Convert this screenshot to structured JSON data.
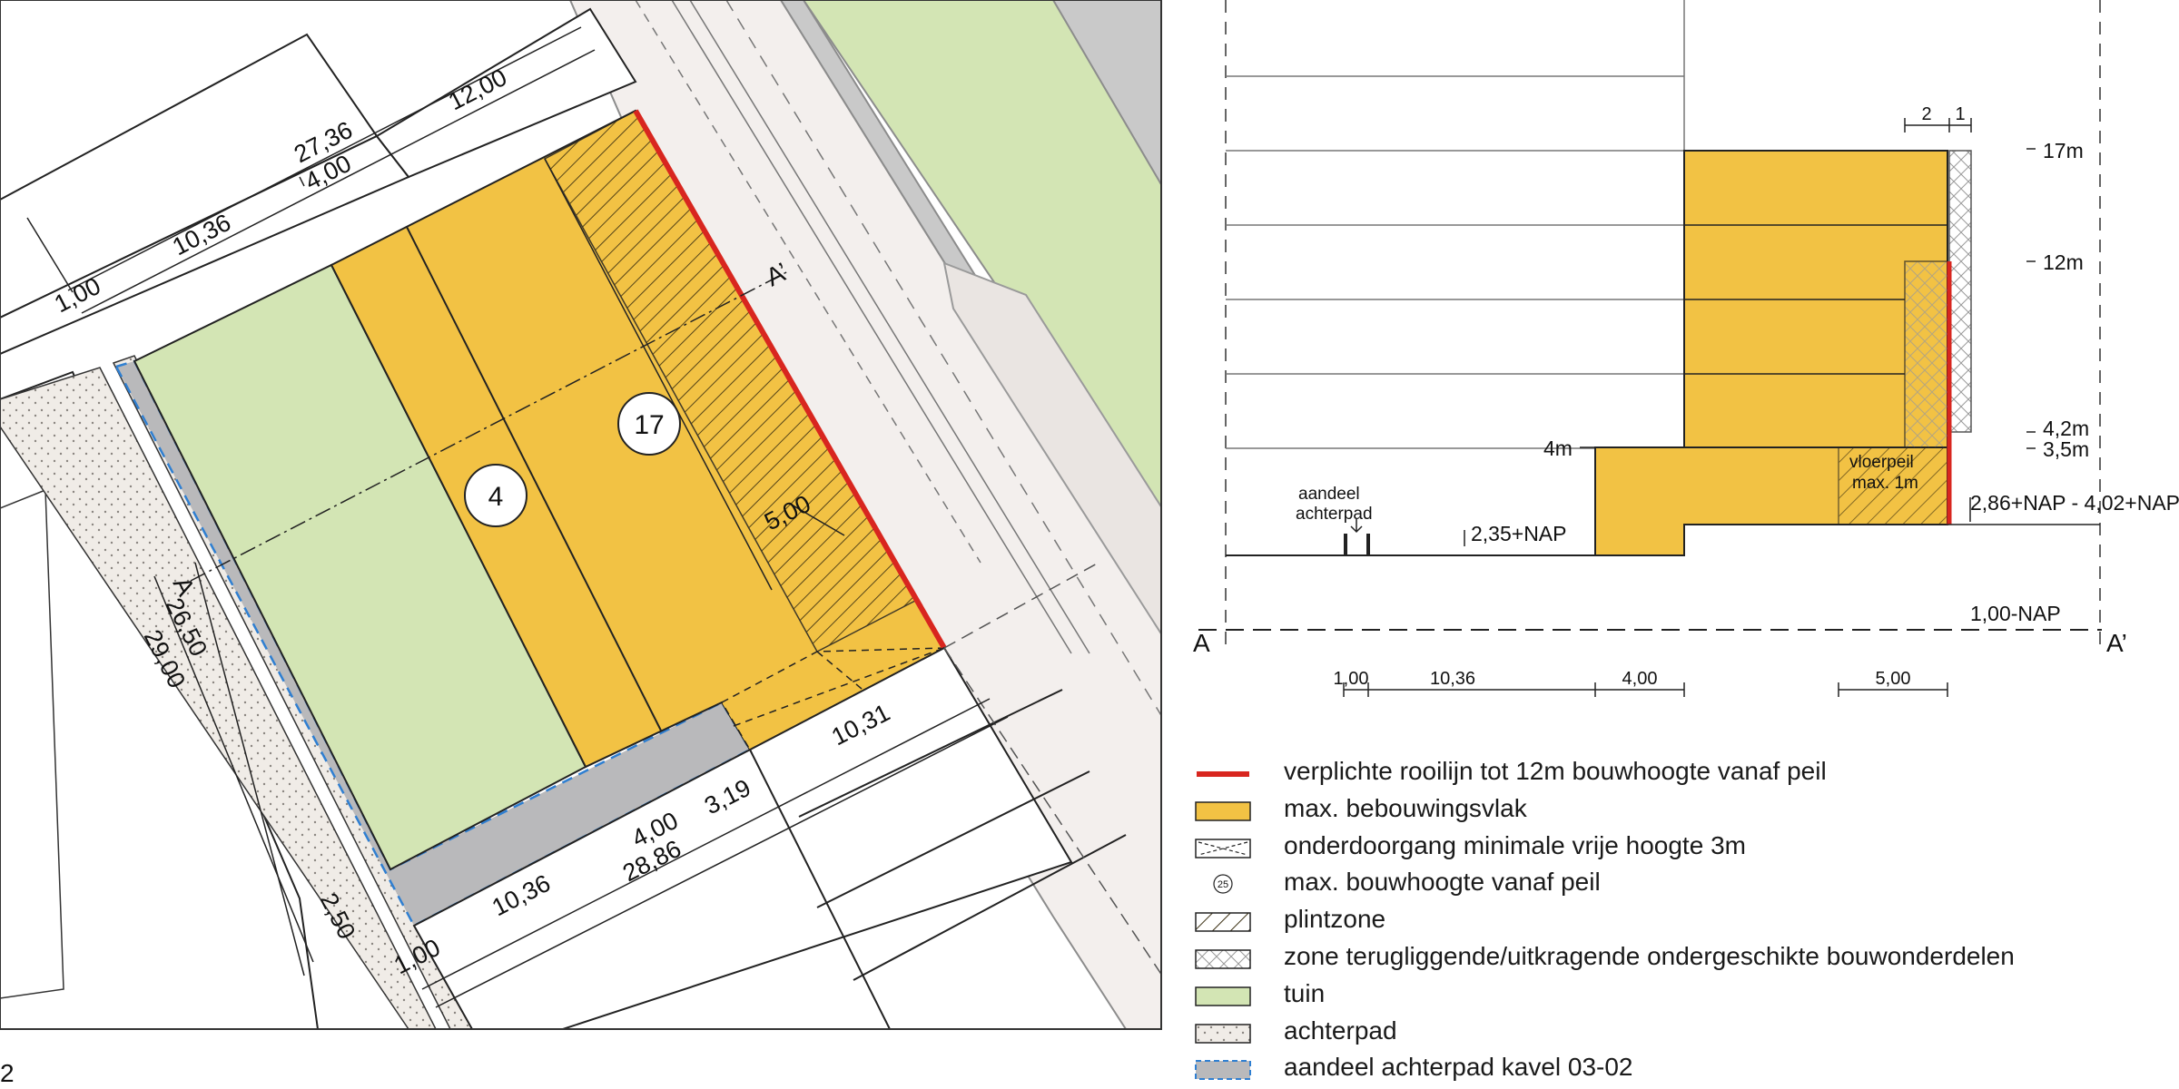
{
  "plan": {
    "dims": {
      "d27_36": "27,36",
      "d12_00": "12,00",
      "d10_36_top": "10,36",
      "d4_00_top": "4,00",
      "d1_00_top": "1,00",
      "d26_50": "26,50",
      "d29_00": "29,00",
      "d2_50": "2,50",
      "d10_31": "10,31",
      "d3_19": "3,19",
      "d4_00_bottom": "4,00",
      "d28_86": "28,86",
      "d10_36_bottom": "10,36",
      "d1_00_bottom": "1,00",
      "d5_00": "5,00"
    },
    "heights": {
      "zone_a": "4",
      "zone_b": "17"
    },
    "section_marks": {
      "a_left": "A",
      "a_right": "A’"
    },
    "corner_label": "2"
  },
  "section": {
    "levels": {
      "l17": "17m",
      "l12": "12m",
      "l4_2": "4,2m",
      "l3_5": "3,5m",
      "l4": "4m"
    },
    "labels": {
      "aandeel": "aandeel",
      "achterpad": "achterpad",
      "nap_2_35": "2,35+NAP",
      "nap_range": "2,86+NAP - 4,02+NAP",
      "nap_1_00": "1,00-NAP",
      "vloerpeil": "vloerpeil",
      "max1m": "max. 1m",
      "a_left": "A",
      "a_right": "A’"
    },
    "top_dims": {
      "d2": "2",
      "d1": "1"
    },
    "bottom_dims": {
      "d1_00": "1,00",
      "d10_36": "10,36",
      "d4_00": "4,00",
      "d5_00": "5,00"
    }
  },
  "legend": {
    "items": [
      {
        "label": "verplichte rooilijn tot 12m bouwhoogte vanaf peil"
      },
      {
        "label": "max. bebouwingsvlak"
      },
      {
        "label": "onderdoorgang minimale vrije hoogte 3m"
      },
      {
        "label": "max. bouwhoogte vanaf peil",
        "symbol_text": "25"
      },
      {
        "label": "plintzone"
      },
      {
        "label": "zone terugliggende/uitkragende ondergeschikte bouwonderdelen"
      },
      {
        "label": "tuin"
      },
      {
        "label": "achterpad"
      },
      {
        "label": "aandeel achterpad kavel 03-02"
      }
    ]
  },
  "colors": {
    "orange": "#f2c244",
    "green": "#d3e5b4",
    "grey": "#b9b9bb",
    "red": "#d8261f",
    "road": "#f3efed",
    "blue_dash": "#2f7fd1",
    "dots": "#f0ece7"
  }
}
